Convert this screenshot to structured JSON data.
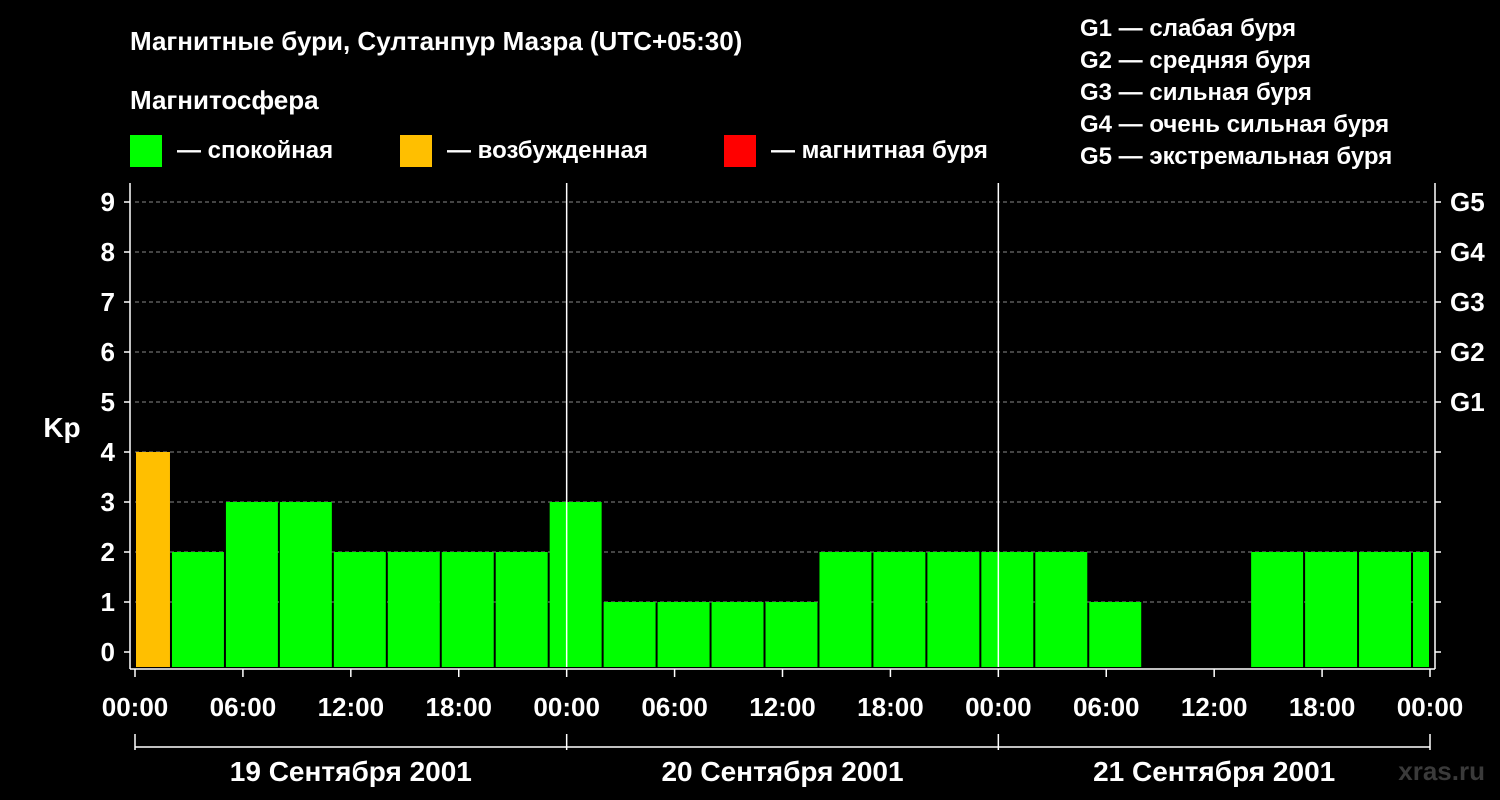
{
  "title": "Магнитные бури, Султанпур Мазра (UTC+05:30)",
  "magnetosphere_label": "Магнитосфера",
  "legend_states": [
    {
      "color": "#00ff00",
      "label": "— спокойная"
    },
    {
      "color": "#ffbf00",
      "label": "— возбужденная"
    },
    {
      "color": "#ff0000",
      "label": "— магнитная буря"
    }
  ],
  "g_legend": [
    "G1 — слабая буря",
    "G2 — средняя буря",
    "G3 — сильная буря",
    "G4 — очень сильная буря",
    "G5 — экстремальная буря"
  ],
  "watermark": "xras.ru",
  "chart_data": {
    "type": "bar",
    "ylabel": "Kp",
    "ylim": [
      0,
      9
    ],
    "y_ticks": [
      "0",
      "1",
      "2",
      "3",
      "4",
      "5",
      "6",
      "7",
      "8",
      "9"
    ],
    "right_ticks": [
      {
        "y": 5,
        "label": "G1"
      },
      {
        "y": 6,
        "label": "G2"
      },
      {
        "y": 7,
        "label": "G3"
      },
      {
        "y": 8,
        "label": "G4"
      },
      {
        "y": 9,
        "label": "G5"
      }
    ],
    "x_range_hours": [
      0,
      72
    ],
    "x_tick_labels": [
      "00:00",
      "06:00",
      "12:00",
      "18:00",
      "00:00",
      "06:00",
      "12:00",
      "18:00",
      "00:00",
      "06:00",
      "12:00",
      "18:00",
      "00:00"
    ],
    "day_labels": [
      "19 Сентября 2001",
      "20 Сентября 2001",
      "21 Сентября 2001"
    ],
    "grid": "horizontal dashed",
    "bars": [
      {
        "start_hour": 0,
        "end_hour": 2,
        "kp": 4,
        "color": "#ffbf00"
      },
      {
        "start_hour": 2,
        "end_hour": 5,
        "kp": 2,
        "color": "#00ff00"
      },
      {
        "start_hour": 5,
        "end_hour": 8,
        "kp": 3,
        "color": "#00ff00"
      },
      {
        "start_hour": 8,
        "end_hour": 11,
        "kp": 3,
        "color": "#00ff00"
      },
      {
        "start_hour": 11,
        "end_hour": 14,
        "kp": 2,
        "color": "#00ff00"
      },
      {
        "start_hour": 14,
        "end_hour": 17,
        "kp": 2,
        "color": "#00ff00"
      },
      {
        "start_hour": 17,
        "end_hour": 20,
        "kp": 2,
        "color": "#00ff00"
      },
      {
        "start_hour": 20,
        "end_hour": 23,
        "kp": 2,
        "color": "#00ff00"
      },
      {
        "start_hour": 23,
        "end_hour": 26,
        "kp": 3,
        "color": "#00ff00"
      },
      {
        "start_hour": 26,
        "end_hour": 29,
        "kp": 1,
        "color": "#00ff00"
      },
      {
        "start_hour": 29,
        "end_hour": 32,
        "kp": 1,
        "color": "#00ff00"
      },
      {
        "start_hour": 32,
        "end_hour": 35,
        "kp": 1,
        "color": "#00ff00"
      },
      {
        "start_hour": 35,
        "end_hour": 38,
        "kp": 1,
        "color": "#00ff00"
      },
      {
        "start_hour": 38,
        "end_hour": 41,
        "kp": 2,
        "color": "#00ff00"
      },
      {
        "start_hour": 41,
        "end_hour": 44,
        "kp": 2,
        "color": "#00ff00"
      },
      {
        "start_hour": 44,
        "end_hour": 47,
        "kp": 2,
        "color": "#00ff00"
      },
      {
        "start_hour": 47,
        "end_hour": 50,
        "kp": 2,
        "color": "#00ff00"
      },
      {
        "start_hour": 50,
        "end_hour": 53,
        "kp": 2,
        "color": "#00ff00"
      },
      {
        "start_hour": 53,
        "end_hour": 56,
        "kp": 1,
        "color": "#00ff00"
      },
      {
        "start_hour": 56,
        "end_hour": 59,
        "kp": 0,
        "color": "#00ff00"
      },
      {
        "start_hour": 59,
        "end_hour": 62,
        "kp": 0,
        "color": "#00ff00"
      },
      {
        "start_hour": 62,
        "end_hour": 65,
        "kp": 2,
        "color": "#00ff00"
      },
      {
        "start_hour": 65,
        "end_hour": 68,
        "kp": 2,
        "color": "#00ff00"
      },
      {
        "start_hour": 68,
        "end_hour": 71,
        "kp": 2,
        "color": "#00ff00"
      },
      {
        "start_hour": 71,
        "end_hour": 72,
        "kp": 2,
        "color": "#00ff00"
      }
    ]
  }
}
